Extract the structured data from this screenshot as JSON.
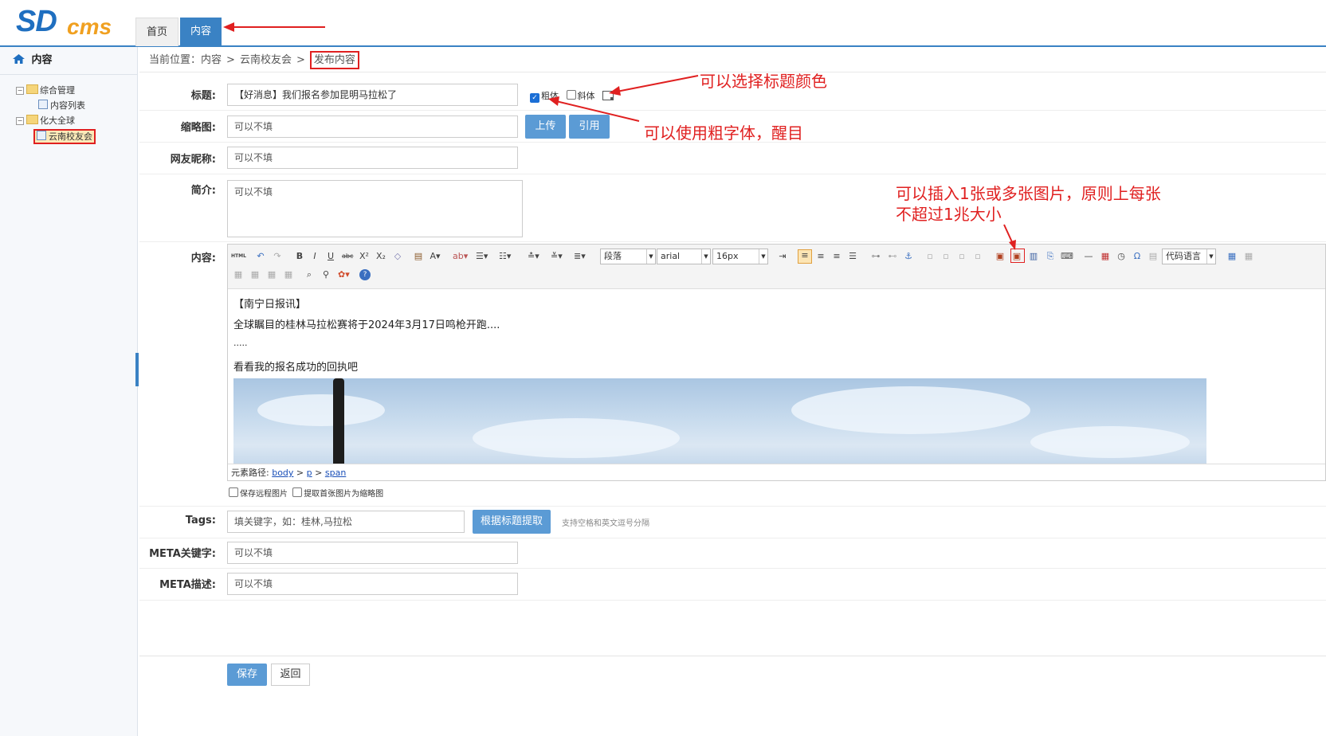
{
  "logo": {
    "sd": "SD",
    "cms": "cms"
  },
  "top_tabs": [
    "首页",
    "内容"
  ],
  "sidebar": {
    "header": "内容",
    "tree": [
      {
        "label": "综合管理"
      },
      {
        "label": "内容列表"
      },
      {
        "label": "化大全球"
      },
      {
        "label": "云南校友会"
      }
    ]
  },
  "breadcrumb": {
    "prefix": "当前位置：",
    "items": [
      "内容",
      "云南校友会"
    ],
    "current": "发布内容",
    "sep": ">"
  },
  "form": {
    "title_label": "标题:",
    "title_value": "【好消息】我们报名参加昆明马拉松了",
    "bold_label": "粗体",
    "italic_label": "斜体",
    "thumb_label": "缩略图:",
    "thumb_placeholder": "可以不填",
    "upload_label": "上传",
    "cite_label": "引用",
    "nick_label": "网友昵称:",
    "nick_placeholder": "可以不填",
    "intro_label": "简介:",
    "intro_placeholder": "可以不填",
    "content_label": "内容:",
    "tags_label": "Tags:",
    "tags_placeholder": "填关键字，如：桂林,马拉松",
    "tags_button": "根据标题提取",
    "tags_hint": "支持空格和英文逗号分隔",
    "meta_kw_label": "META关键字:",
    "meta_kw_placeholder": "可以不填",
    "meta_desc_label": "META描述:",
    "meta_desc_placeholder": "可以不填",
    "save_remote": "保存远程图片",
    "first_as_thumb": "提取首张图片为缩略图",
    "save_button": "保存",
    "back_button": "返回"
  },
  "editor": {
    "paragraph": "段落",
    "font": "arial",
    "size": "16px",
    "code_lang": "代码语言",
    "lines": [
      "【南宁日报讯】",
      "全球瞩目的桂林马拉松赛将于2024年3月17日鸣枪开跑....",
      ".....",
      "看看我的报名成功的回执吧"
    ],
    "path_label": "元素路径:",
    "path": [
      "body",
      "p",
      "span"
    ]
  },
  "annotations": {
    "color": "可以选择标题颜色",
    "bold": "可以使用粗字体，醒目",
    "image_line1": "可以插入1张或多张图片，原则上每张",
    "image_line2": "不超过1兆大小"
  },
  "colors": {
    "accent": "#3a82c4",
    "button": "#5b9bd5",
    "annotation": "#e02020"
  }
}
